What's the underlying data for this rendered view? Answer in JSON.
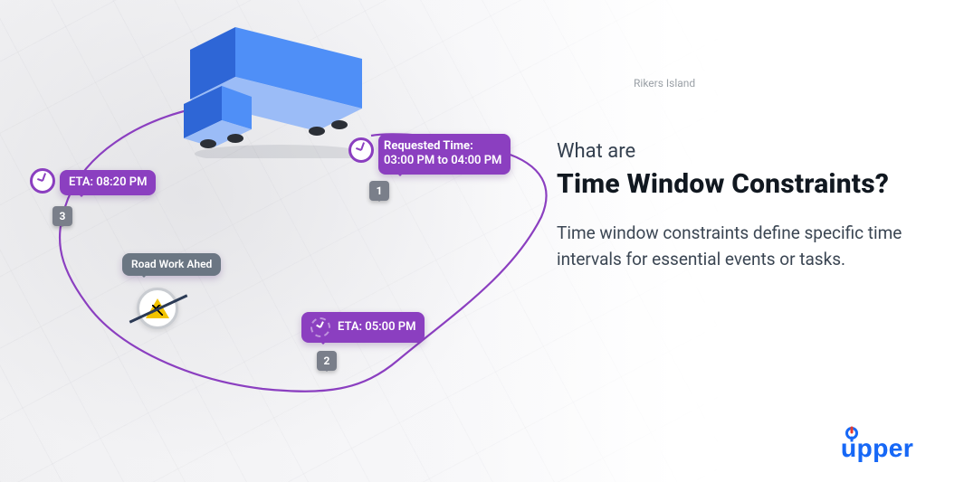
{
  "title_lead": "What are",
  "title_main": "Time Window Constraints?",
  "description": "Time window constraints define specific time intervals for essential events or tasks.",
  "map": {
    "labels": {
      "rikers_island": "Rikers Island"
    },
    "waypoints": [
      {
        "num": "1"
      },
      {
        "num": "2"
      },
      {
        "num": "3"
      }
    ],
    "stop1": {
      "label_line1": "Requested Time:",
      "label_line2": "03:00 PM to 04:00 PM"
    },
    "stop2": {
      "label": "ETA: 05:00 PM"
    },
    "stop3": {
      "label": "ETA: 08:20 PM"
    },
    "roadwork": {
      "label": "Road Work Ahed"
    }
  },
  "brand": "upper"
}
